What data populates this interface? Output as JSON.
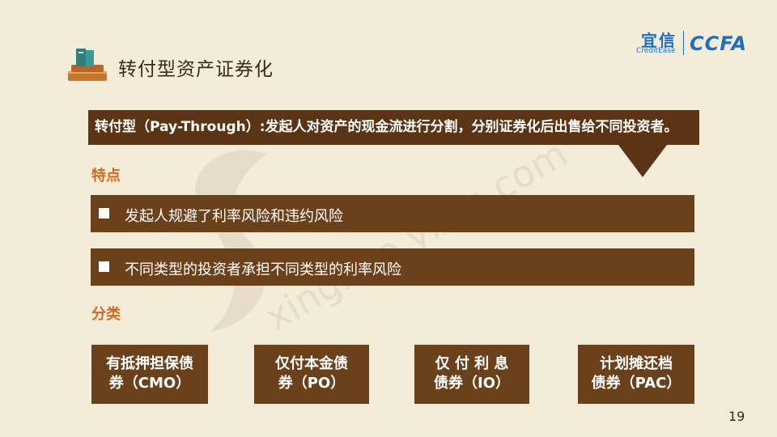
{
  "header": {
    "title": "转付型资产证券化",
    "logo": {
      "cn": "宜信",
      "en": "CreditEase",
      "ccfa": "CCFA"
    }
  },
  "definition": "转付型（Pay-Through）:发起人对资产的现金流进行分割，分别证券化后出售给不同投资者。",
  "features": {
    "heading": "特点",
    "items": [
      "发起人规避了利率风险和违约风险",
      "不同类型的投资者承担不同类型的利率风险"
    ]
  },
  "categories": {
    "heading": "分类",
    "items": [
      {
        "line1": "有抵押担保债",
        "line2": "券（CMO）"
      },
      {
        "line1": "仅付本金债",
        "line2": "券（PO）"
      },
      {
        "line1": "仅 付 利 息",
        "line2": "债券（IO）"
      },
      {
        "line1": "计划摊还档",
        "line2": "债券（PAC）"
      }
    ]
  },
  "watermark": "xinghuo.yixin.com",
  "page_number": "19",
  "colors": {
    "background": "#f3ecd9",
    "box": "#6a411b",
    "accent": "#cf6b22",
    "logo": "#1f6fc0"
  }
}
